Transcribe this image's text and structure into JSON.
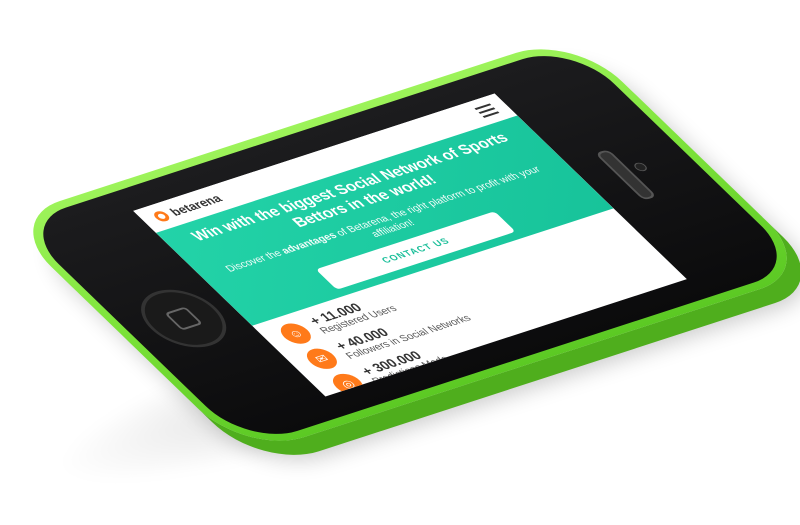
{
  "app": {
    "brand": "betarena",
    "hero": {
      "title": "Win with the biggest Social Network of Sports Bettors in the world!",
      "subtitle_prefix": "Discover the ",
      "subtitle_bold": "advantages",
      "subtitle_suffix": " of Betarena, the right platform to profit with your affiliation!",
      "cta": "CONTACT US"
    },
    "stats": [
      {
        "value": "+ 11.000",
        "label": "Registered Users",
        "icon": "user-icon"
      },
      {
        "value": "+ 40.000",
        "label": "Followers in Social Networks",
        "icon": "chat-icon"
      },
      {
        "value": "+ 300.000",
        "label": "Predictions Made",
        "icon": "target-icon"
      }
    ]
  },
  "colors": {
    "phone_body": "#7de33a",
    "hero_bg": "#1bc69e",
    "accent_orange": "#ff7a1a"
  }
}
